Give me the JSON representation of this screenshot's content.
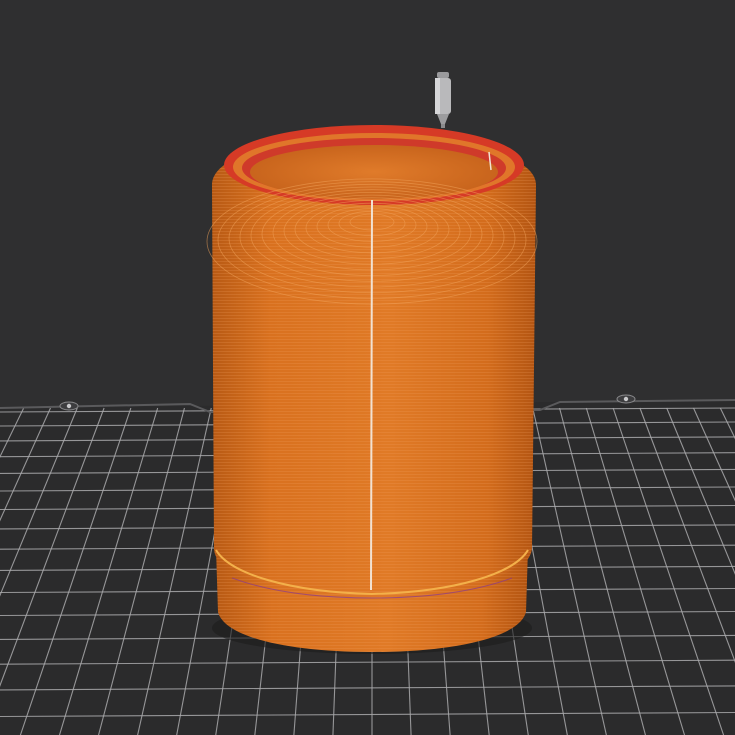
{
  "viewer": {
    "background_color": "#2f2f30",
    "bed_color": "#2a2a2b",
    "bed_grid_color": "#a9a9ab",
    "model_color": "#d9711f",
    "model_shade_color": "#b85a14",
    "model_highlight_color": "#e98a3a",
    "rim_color": "#d93a2a",
    "seam_color": "#f2e2d2",
    "nozzle_color": "#b8b8b8"
  },
  "icons": {
    "nozzle": "nozzle-icon",
    "bed_clip": "bed-clip-icon"
  }
}
